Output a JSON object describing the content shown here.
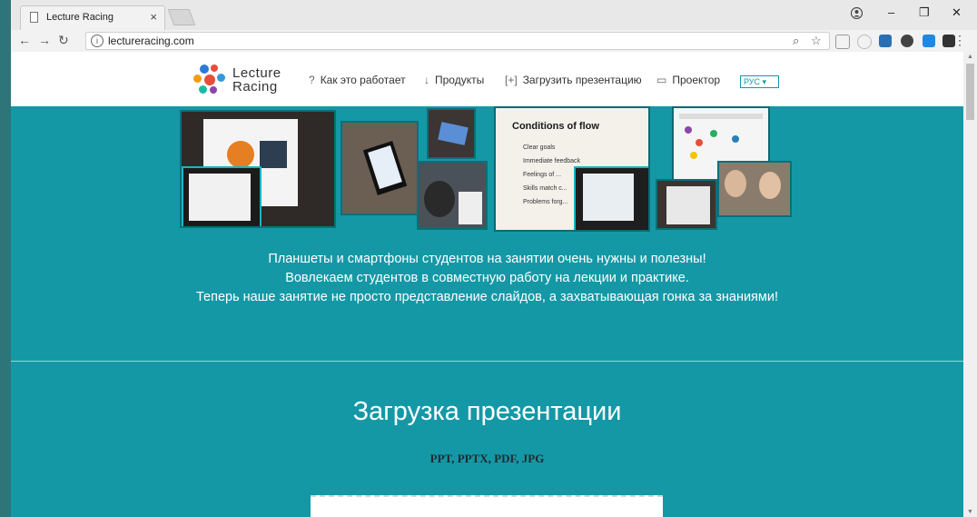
{
  "browser": {
    "tab_title": "Lecture Racing",
    "tab_close": "×",
    "url": "lectureracing.com",
    "window_controls": [
      "–",
      "❐",
      "✕"
    ]
  },
  "site": {
    "logo_line1": "Lecture",
    "logo_line2": "Racing",
    "nav": [
      {
        "icon": "?",
        "label": "Как это работает"
      },
      {
        "icon": "↓",
        "label": "Продукты"
      },
      {
        "icon": "[+]",
        "label": "Загрузить презентацию"
      },
      {
        "icon": "▭",
        "label": "Проектор"
      }
    ],
    "lang": "РУС ▾",
    "tagline": [
      "Планшеты и смартфоны студентов на занятии очень нужны и полезны!",
      "Вовлекаем студентов в совместную работу на лекции и практике.",
      "Теперь наше занятие не просто представление слайдов, а захватывающая гонка за знаниями!"
    ],
    "upload_title": "Загрузка презентации",
    "formats": "PPT, PPTX, PDF, JPG",
    "slide_text": {
      "heading": "Conditions of flow",
      "items": [
        "Clear goals",
        "Immediate feedback",
        "Feelings of ...",
        "Skills match c...",
        "Problems forg..."
      ]
    }
  },
  "colors": {
    "teal": "#1598a6",
    "dark_teal": "#2e7579",
    "logo_dots": [
      "#2b7bd6",
      "#e84c3d",
      "#f39c12",
      "#1abc9c",
      "#8e44ad",
      "#3498db",
      "#e74c3c"
    ]
  }
}
